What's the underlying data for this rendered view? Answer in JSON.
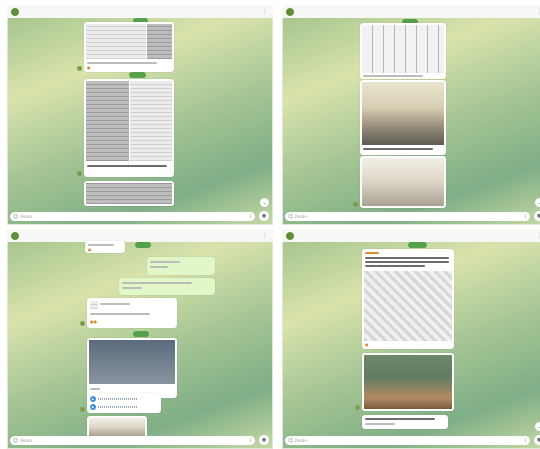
{
  "panels": [
    {
      "name": "",
      "status": "",
      "input_placeholder": "Pesan"
    },
    {
      "name": "",
      "status": "",
      "input_placeholder": "Pesan"
    },
    {
      "name": "",
      "status": "",
      "input_placeholder": "Pesan"
    },
    {
      "name": "",
      "status": "",
      "input_placeholder": "Pesan"
    }
  ],
  "icons": {
    "emoji": "emoji-icon",
    "attach": "paperclip-icon",
    "send": "microphone-icon",
    "scroll": "chevron-down-icon",
    "header_menu": "more-icon"
  },
  "colors": {
    "date_pill": "#55a04a",
    "own_bubble": "#e2f7c8",
    "header": "#f7f8f5"
  }
}
